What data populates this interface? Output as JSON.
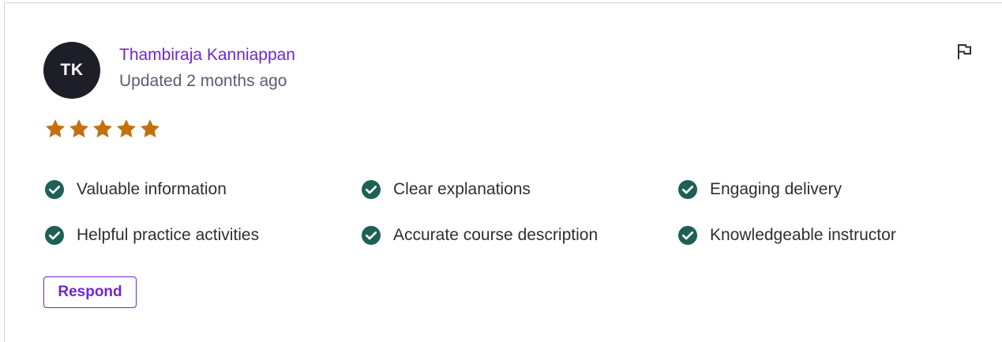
{
  "review": {
    "avatar_initials": "TK",
    "author_name": "Thambiraja Kanniappan",
    "updated_text": "Updated 2 months ago",
    "rating": 5,
    "rating_max": 5,
    "star_color": "#c4710d",
    "flag_icon": "flag-icon",
    "tags": [
      {
        "label": "Valuable information",
        "icon": "check-circle-icon"
      },
      {
        "label": "Clear explanations",
        "icon": "check-circle-icon"
      },
      {
        "label": "Engaging delivery",
        "icon": "check-circle-icon"
      },
      {
        "label": "Helpful practice activities",
        "icon": "check-circle-icon"
      },
      {
        "label": "Accurate course description",
        "icon": "check-circle-icon"
      },
      {
        "label": "Knowledgeable instructor",
        "icon": "check-circle-icon"
      }
    ],
    "check_color": "#1e6055",
    "respond_label": "Respond",
    "accent_color": "#6d28d2"
  }
}
